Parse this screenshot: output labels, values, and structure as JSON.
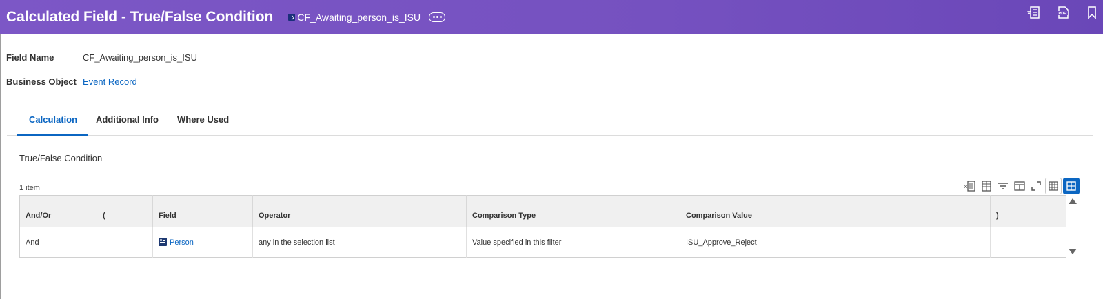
{
  "header": {
    "title": "Calculated Field - True/False Condition",
    "instance_label": "CF_Awaiting_person_is_ISU",
    "actions": {
      "excel": "excel-export-icon",
      "pdf": "pdf-export-icon",
      "bookmark": "bookmark-icon"
    },
    "colors": {
      "accent": "#7551c0",
      "link": "#0b66c2"
    }
  },
  "fields": {
    "field_name_label": "Field Name",
    "field_name_value": "CF_Awaiting_person_is_ISU",
    "business_object_label": "Business Object",
    "business_object_value": "Event Record"
  },
  "tabs": [
    {
      "label": "Calculation",
      "active": true
    },
    {
      "label": "Additional Info",
      "active": false
    },
    {
      "label": "Where Used",
      "active": false
    }
  ],
  "section": {
    "title": "True/False Condition",
    "item_count": "1 item"
  },
  "grid": {
    "columns": [
      "And/Or",
      "(",
      "Field",
      "Operator",
      "Comparison Type",
      "Comparison Value",
      ")"
    ],
    "rows": [
      {
        "and_or": "And",
        "open_paren": "",
        "field": "Person",
        "operator": "any in the selection list",
        "comparison_type": "Value specified in this filter",
        "comparison_value": "ISU_Approve_Reject",
        "close_paren": ""
      }
    ]
  }
}
